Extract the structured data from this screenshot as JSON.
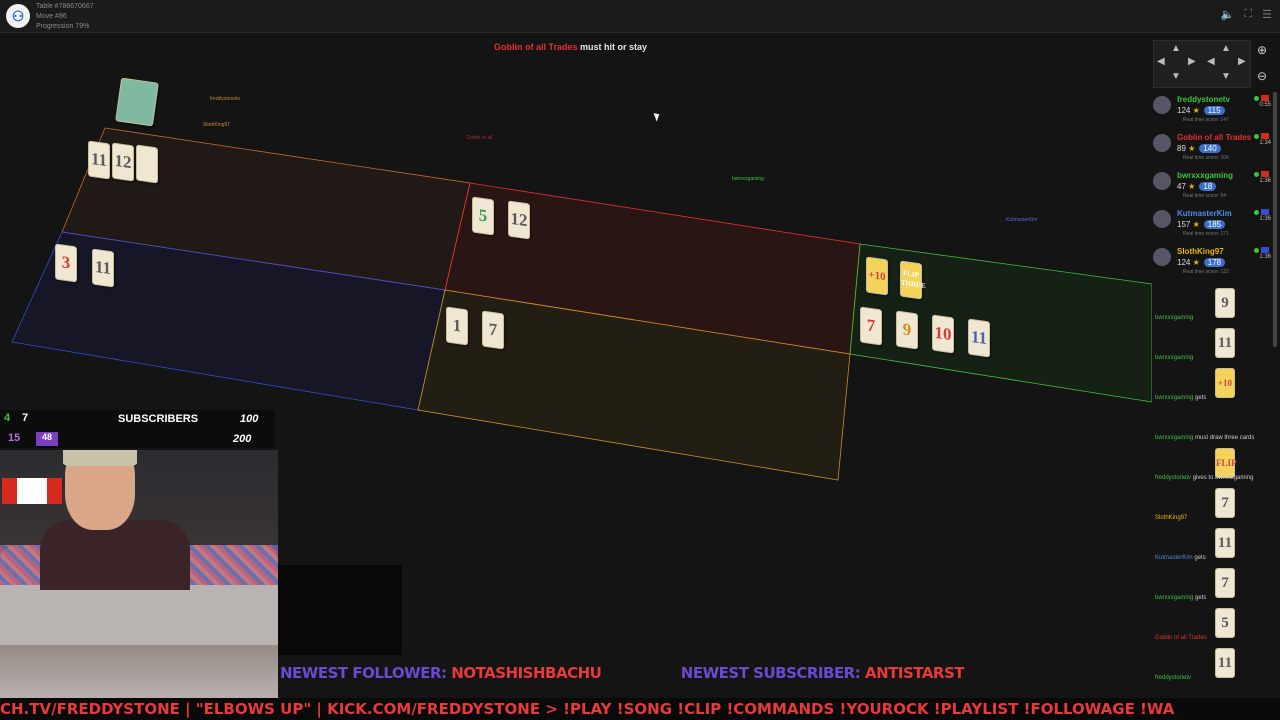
{
  "header": {
    "table": "Table #786670667",
    "move": "Move #86",
    "progression": "Progression 79%",
    "logo_letter": "⚇"
  },
  "status": {
    "player": "Goblin of all Trades",
    "text": " must hit or stay"
  },
  "zones": [
    {
      "name": "freddystonetv",
      "color": "#c86a2a"
    },
    {
      "name": "Goblin of all Trades",
      "color": "#e03030"
    },
    {
      "name": "bwrxxxgaming",
      "color": "#3cc23c"
    },
    {
      "name": "KutmasterKim",
      "color": "#3a4ad0"
    },
    {
      "name": "SlothKing97",
      "color": "#c89020"
    }
  ],
  "hands": {
    "freddy": [
      "11",
      "12"
    ],
    "goblin": [
      "5",
      "12"
    ],
    "kutmaster": [
      "3",
      "11"
    ],
    "sloth": [
      "1",
      "7"
    ],
    "bwrxxx_top": [
      "+10",
      "FLIP THREE"
    ],
    "bwrxxx_bottom": [
      "7",
      "9",
      "10",
      "11"
    ]
  },
  "seat_labels": {
    "freddy": "freddystonetv",
    "sloth": "SlothKing97",
    "goblin": "Goblin of all",
    "bwrxxx": "bwrxxxgaming",
    "kutmaster": "KutmasterKim"
  },
  "scoreboard": [
    {
      "name": "freddystonetv",
      "name_color": "#3cc23c",
      "score": "124",
      "badge": "115",
      "real": "Real time score: 147",
      "time": "0:55"
    },
    {
      "name": "Goblin of all Trades",
      "name_color": "#e03030",
      "score": "89",
      "badge": "140",
      "real": "Real time score: 106",
      "time": "1:34"
    },
    {
      "name": "bwrxxxgaming",
      "name_color": "#3cc23c",
      "score": "47",
      "badge": "18",
      "real": "Real time score: 94",
      "time": "1:36"
    },
    {
      "name": "KutmasterKim",
      "name_color": "#4a8ae8",
      "score": "157",
      "badge": "185",
      "real": "Real time score: 171",
      "time": "1:36"
    },
    {
      "name": "SlothKing97",
      "name_color": "#e6b800",
      "score": "124",
      "badge": "178",
      "real": "Real time score: 132",
      "time": "1:36"
    }
  ],
  "log": [
    {
      "name": "bwrxxxgaming",
      "color": "#3cc23c",
      "card": "9",
      "suffix": ""
    },
    {
      "name": "bwrxxxgaming",
      "color": "#3cc23c",
      "card": "11",
      "suffix": ""
    },
    {
      "name": "bwrxxxgaming",
      "color": "#3cc23c",
      "card": "+10",
      "suffix": " gets"
    },
    {
      "name": "bwrxxxgaming",
      "color": "#3cc23c",
      "card": "",
      "suffix": " must draw three cards"
    },
    {
      "name": "freddystonetv",
      "color": "#3cc23c",
      "card": "FLIP",
      "suffix": " gives to bwrxxxgaming"
    },
    {
      "name": "SlothKing97",
      "color": "#e6b800",
      "card": "7",
      "suffix": ""
    },
    {
      "name": "KutmasterKim",
      "color": "#4a8ae8",
      "card": "11",
      "suffix": " gets"
    },
    {
      "name": "bwrxxxgaming",
      "color": "#3cc23c",
      "card": "7",
      "suffix": " gets"
    },
    {
      "name": "Goblin of all Trades",
      "color": "#e03030",
      "card": "5",
      "suffix": ""
    },
    {
      "name": "freddystonetv",
      "color": "#3cc23c",
      "card": "11",
      "suffix": ""
    }
  ],
  "overlay": {
    "counter_a": "4",
    "counter_b": "7",
    "counter_c": "15",
    "counter_d": "48",
    "subscribers_label": "SUBSCRIBERS",
    "subscribers_goal_1": "100",
    "subscribers_goal_2": "200",
    "newest_follower_label": "NEWEST FOLLOWER:",
    "newest_follower": "NOTASHISHBACHU",
    "newest_subscriber_label": "NEWEST SUBSCRIBER:",
    "newest_subscriber": "ANTISTARST",
    "ticker": "CH.TV/FREDDYSTONE  |  \"ELBOWS UP\"  |  KICK.COM/FREDDYSTONE >   !PLAY !SONG !CLIP !COMMANDS  !YOUROCK  !PLAYLIST  !FOLLOWAGE  !WA"
  }
}
